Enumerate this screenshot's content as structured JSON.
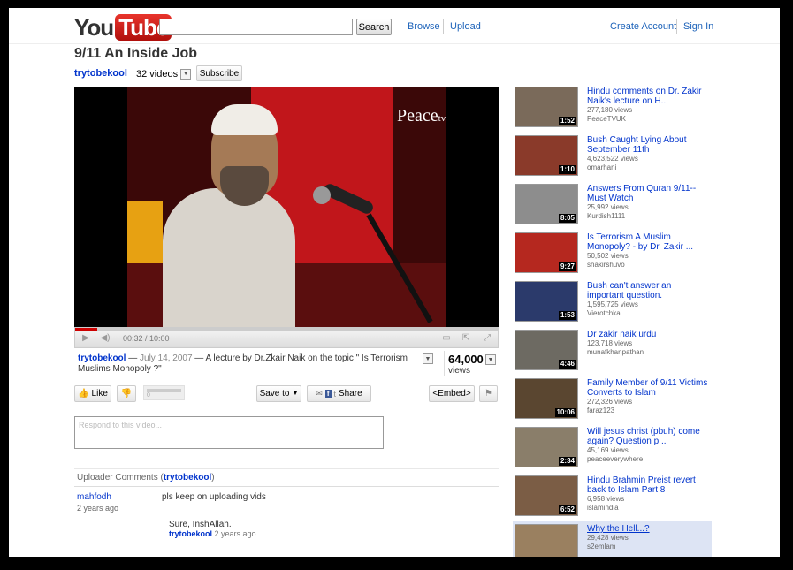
{
  "header": {
    "logo_you": "You",
    "logo_tube": "Tube",
    "search_placeholder": "",
    "search_label": "Search",
    "browse": "Browse",
    "upload": "Upload",
    "create_account": "Create Account",
    "sign_in": "Sign In"
  },
  "video": {
    "title": "9/11 An Inside Job",
    "channel": "trytobekool",
    "video_count": "32 videos",
    "subscribe": "Subscribe",
    "overlay_logo": "Peace",
    "overlay_logo_sub": "tv",
    "time": "00:32 / 10:00",
    "progress_fraction": 0.053
  },
  "info": {
    "by": "trytobekool",
    "dash1": " — ",
    "date": "July 14, 2007",
    "description": " — A lecture by Dr.Zkair Naik on the topic \" Is Terrorism Muslims Monopoly ?\"",
    "views": "64,000",
    "views_label": "views"
  },
  "actions": {
    "like": "Like",
    "rating_value": "0",
    "save_to": "Save to",
    "share": "Share",
    "embed": "<Embed>"
  },
  "comments": {
    "placeholder": "Respond to this video...",
    "header_prefix": "Uploader Comments (",
    "header_user": "trytobekool",
    "header_suffix": ")",
    "items": [
      {
        "user": "mahfodh",
        "time": "2 years ago",
        "text": "pls keep on uploading vids"
      }
    ],
    "reply": {
      "text": "Sure, InshAllah.",
      "user": "trytobekool",
      "time": "2 years ago"
    }
  },
  "related": [
    {
      "title": "Hindu comments on Dr. Zakir Naik's lecture on H...",
      "views": "277,180 views",
      "user": "PeaceTVUK",
      "duration": "1:52",
      "thumb_color": "#7a6a5a"
    },
    {
      "title": "Bush Caught Lying About September 11th",
      "views": "4,623,522 views",
      "user": "omarhani",
      "duration": "1:10",
      "thumb_color": "#8a3a2a"
    },
    {
      "title": "Answers From Quran 9/11-- Must Watch",
      "views": "25,992 views",
      "user": "Kurdish1111",
      "duration": "8:05",
      "thumb_color": "#8d8d8d"
    },
    {
      "title": "Is Terrorism A Muslim Monopoly? - by Dr. Zakir ...",
      "views": "50,502 views",
      "user": "shakirshuvo",
      "duration": "9:27",
      "thumb_color": "#b5281f"
    },
    {
      "title": "Bush can't answer an important question.",
      "views": "1,595,725 views",
      "user": "Vierotchka",
      "duration": "1:53",
      "thumb_color": "#2b3a6b"
    },
    {
      "title": "Dr zakir naik urdu",
      "views": "123,718 views",
      "user": "munafkhanpathan",
      "duration": "4:46",
      "thumb_color": "#6d6a62"
    },
    {
      "title": "Family Member of 9/11 Victims Converts to Islam",
      "views": "272,326 views",
      "user": "faraz123",
      "duration": "10:06",
      "thumb_color": "#5a4630"
    },
    {
      "title": "Will jesus christ (pbuh) come again? Question p...",
      "views": "45,169 views",
      "user": "peaceeverywhere",
      "duration": "2:34",
      "thumb_color": "#8a7e6a"
    },
    {
      "title": "Hindu Brahmin Preist revert back to Islam Part 8",
      "views": "6,958 views",
      "user": "islamindia",
      "duration": "6:52",
      "thumb_color": "#7b5d45"
    },
    {
      "title": "Why the Hell...?",
      "views": "29,428 views",
      "user": "s2emlam",
      "duration": "",
      "thumb_color": "#9a8060"
    }
  ]
}
